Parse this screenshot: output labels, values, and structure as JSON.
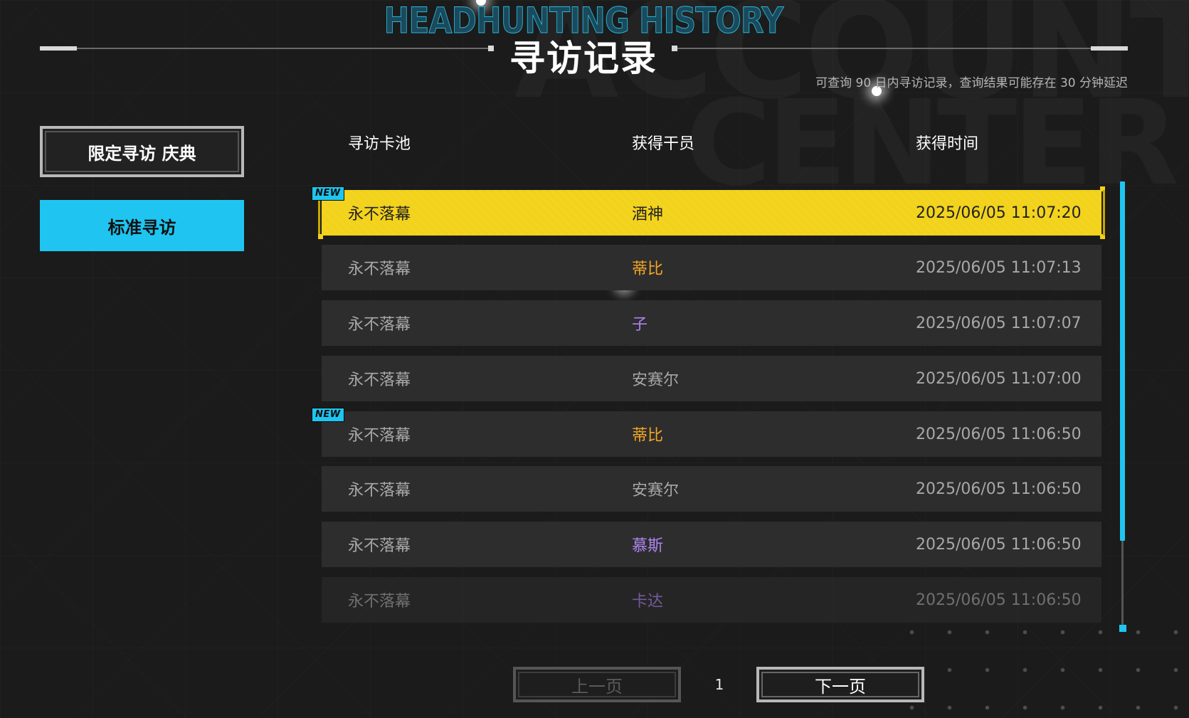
{
  "header": {
    "title_en": "HEADHUNTING HISTORY",
    "title_cn": "寻访记录",
    "notice": "可查询 90 日内寻访记录，查询结果可能存在 30 分钟延迟"
  },
  "background": {
    "word1": "ACCOUNT",
    "word2": "CENTER"
  },
  "sidebar": {
    "items": [
      {
        "label": "限定寻访 庆典",
        "selected": false
      },
      {
        "label": "标准寻访",
        "selected": true
      }
    ]
  },
  "table": {
    "headers": [
      "寻访卡池",
      "获得干员",
      "获得时间"
    ],
    "badge": "NEW",
    "rows": [
      {
        "pool": "永不落幕",
        "operator": "酒神",
        "time": "2025/06/05 11:07:20",
        "color": "#222222",
        "new": true,
        "highlight": true
      },
      {
        "pool": "永不落幕",
        "operator": "蒂比",
        "time": "2025/06/05 11:07:13",
        "color": "#f5a623",
        "new": false,
        "highlight": false
      },
      {
        "pool": "永不落幕",
        "operator": "子",
        "time": "2025/06/05 11:07:07",
        "color": "#b084f0",
        "new": false,
        "highlight": false
      },
      {
        "pool": "永不落幕",
        "operator": "安赛尔",
        "time": "2025/06/05 11:07:00",
        "color": "#a8a8a8",
        "new": false,
        "highlight": false
      },
      {
        "pool": "永不落幕",
        "operator": "蒂比",
        "time": "2025/06/05 11:06:50",
        "color": "#f5a623",
        "new": true,
        "highlight": false
      },
      {
        "pool": "永不落幕",
        "operator": "安赛尔",
        "time": "2025/06/05 11:06:50",
        "color": "#a8a8a8",
        "new": false,
        "highlight": false
      },
      {
        "pool": "永不落幕",
        "operator": "慕斯",
        "time": "2025/06/05 11:06:50",
        "color": "#b084f0",
        "new": false,
        "highlight": false
      },
      {
        "pool": "永不落幕",
        "operator": "卡达",
        "time": "2025/06/05 11:06:50",
        "color": "#b084f0",
        "new": false,
        "highlight": false
      }
    ]
  },
  "pagination": {
    "prev_label": "上一页",
    "next_label": "下一页",
    "current_page": "1"
  },
  "colors": {
    "accent": "#1fc5f0",
    "highlight": "#f2d21a",
    "six_star": "#f5a623",
    "four_star": "#b084f0",
    "background": "#1b1b1b"
  }
}
